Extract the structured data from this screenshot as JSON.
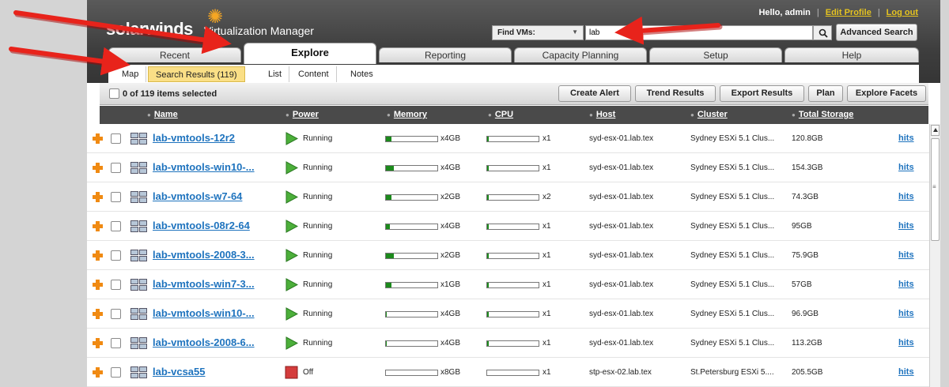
{
  "header": {
    "brand": "solarwinds",
    "product": "Virtualization Manager",
    "greeting": "Hello, admin",
    "edit_profile": "Edit Profile",
    "logout": "Log out"
  },
  "search": {
    "scope": "Find VMs:",
    "query": "lab",
    "advanced_label": "Advanced Search"
  },
  "tabs": [
    "Recent",
    "Explore",
    "Reporting",
    "Capacity Planning",
    "Setup",
    "Help"
  ],
  "active_tab": "Explore",
  "subtabs": [
    "Map",
    "Search Results (119)",
    "List",
    "Content",
    "Notes"
  ],
  "active_subtab": "Search Results (119)",
  "toolbar": {
    "selection": "0 of 119 items selected",
    "buttons": [
      "Create Alert",
      "Trend Results",
      "Export Results",
      "Plan",
      "Explore Facets"
    ]
  },
  "columns": [
    "Name",
    "Power",
    "Memory",
    "CPU",
    "Host",
    "Cluster",
    "Total Storage"
  ],
  "rows": [
    {
      "name": "lab-vmtools-12r2",
      "power": "Running",
      "mem": "x4GB",
      "mem_usage": 0.1,
      "cpu": "x1",
      "cpu_usage": 0.02,
      "host": "syd-esx-01.lab.tex",
      "cluster": "Sydney ESXi 5.1 Clus...",
      "storage": "120.8GB",
      "hits": "hits"
    },
    {
      "name": "lab-vmtools-win10-...",
      "power": "Running",
      "mem": "x4GB",
      "mem_usage": 0.15,
      "cpu": "x1",
      "cpu_usage": 0.02,
      "host": "syd-esx-01.lab.tex",
      "cluster": "Sydney ESXi 5.1 Clus...",
      "storage": "154.3GB",
      "hits": "hits"
    },
    {
      "name": "lab-vmtools-w7-64",
      "power": "Running",
      "mem": "x2GB",
      "mem_usage": 0.1,
      "cpu": "x2",
      "cpu_usage": 0.02,
      "host": "syd-esx-01.lab.tex",
      "cluster": "Sydney ESXi 5.1 Clus...",
      "storage": "74.3GB",
      "hits": "hits"
    },
    {
      "name": "lab-vmtools-08r2-64",
      "power": "Running",
      "mem": "x4GB",
      "mem_usage": 0.08,
      "cpu": "x1",
      "cpu_usage": 0.02,
      "host": "syd-esx-01.lab.tex",
      "cluster": "Sydney ESXi 5.1 Clus...",
      "storage": "95GB",
      "hits": "hits"
    },
    {
      "name": "lab-vmtools-2008-3...",
      "power": "Running",
      "mem": "x2GB",
      "mem_usage": 0.15,
      "cpu": "x1",
      "cpu_usage": 0.02,
      "host": "syd-esx-01.lab.tex",
      "cluster": "Sydney ESXi 5.1 Clus...",
      "storage": "75.9GB",
      "hits": "hits"
    },
    {
      "name": "lab-vmtools-win7-3...",
      "power": "Running",
      "mem": "x1GB",
      "mem_usage": 0.1,
      "cpu": "x1",
      "cpu_usage": 0.02,
      "host": "syd-esx-01.lab.tex",
      "cluster": "Sydney ESXi 5.1 Clus...",
      "storage": "57GB",
      "hits": "hits"
    },
    {
      "name": "lab-vmtools-win10-...",
      "power": "Running",
      "mem": "x4GB",
      "mem_usage": 0.02,
      "cpu": "x1",
      "cpu_usage": 0.02,
      "host": "syd-esx-01.lab.tex",
      "cluster": "Sydney ESXi 5.1 Clus...",
      "storage": "96.9GB",
      "hits": "hits"
    },
    {
      "name": "lab-vmtools-2008-6...",
      "power": "Running",
      "mem": "x4GB",
      "mem_usage": 0.02,
      "cpu": "x1",
      "cpu_usage": 0.02,
      "host": "syd-esx-01.lab.tex",
      "cluster": "Sydney ESXi 5.1 Clus...",
      "storage": "113.2GB",
      "hits": "hits"
    },
    {
      "name": "lab-vcsa55",
      "power": "Off",
      "mem": "x8GB",
      "mem_usage": 0.0,
      "cpu": "x1",
      "cpu_usage": 0.0,
      "host": "stp-esx-02.lab.tex",
      "cluster": "St.Petersburg ESXi 5....",
      "storage": "205.5GB",
      "hits": "hits"
    }
  ],
  "colors": {
    "brand_orange": "#f5a623",
    "link": "#1e73be",
    "running": "#4caf3a",
    "off": "#d43c3c",
    "annotation": "#e8231b"
  }
}
